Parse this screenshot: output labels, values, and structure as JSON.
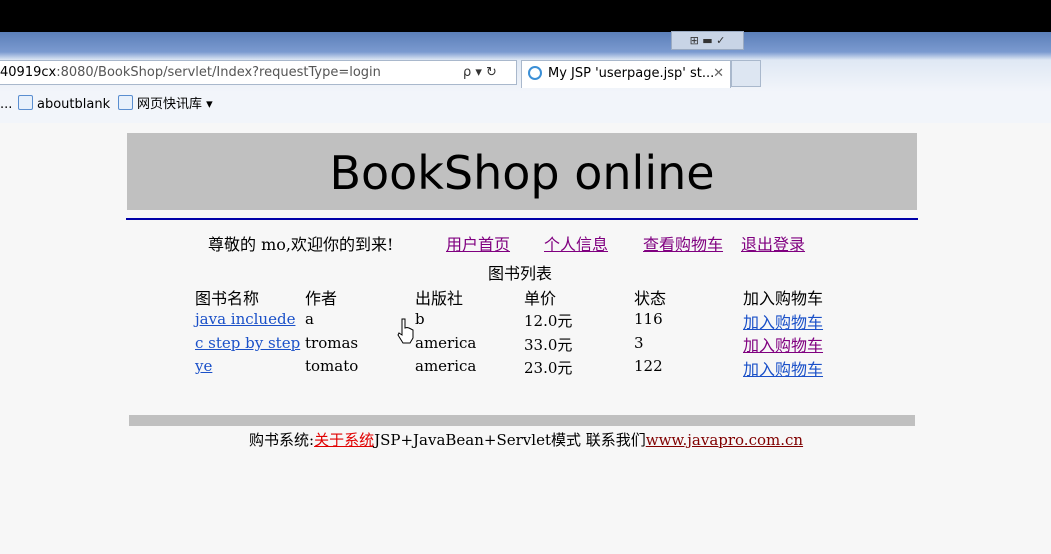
{
  "browser": {
    "address": {
      "host": "40919cx",
      "rest": ":8080/BookShop/servlet/Index?requestType=login"
    },
    "addr_icons": "ρ ▾ ↻",
    "tab": {
      "title": "My JSP 'userpage.jsp' st...",
      "close": "✕"
    },
    "window_controls": "⊞ ▬ ✓",
    "favorites": [
      {
        "label": "..."
      },
      {
        "label": "aboutblank"
      },
      {
        "label": "网页快讯库 ▾"
      }
    ]
  },
  "page": {
    "banner": "BookShop online",
    "welcome": "尊敬的 mo,欢迎你的到来!",
    "nav": [
      "用户首页",
      "个人信息",
      "查看购物车",
      "退出登录"
    ],
    "list_title": "图书列表",
    "columns": [
      "图书名称",
      "作者",
      "出版社",
      "单价",
      "状态",
      "加入购物车"
    ],
    "rows": [
      {
        "name": "java incluede",
        "author": "a",
        "publisher": "b",
        "price": "12.0元",
        "status": "116",
        "cart": "加入购物车"
      },
      {
        "name": "c step by step",
        "author": "tromas",
        "publisher": "america",
        "price": "33.0元",
        "status": "3",
        "cart": "加入购物车"
      },
      {
        "name": "ye",
        "author": "tomato",
        "publisher": "america",
        "price": "23.0元",
        "status": "122",
        "cart": "加入购物车"
      }
    ],
    "footer": {
      "prefix": "购书系统:",
      "about": "关于系统",
      "middle": "JSP+JavaBean+Servlet模式 联系我们",
      "link": "www.javapro.com.cn"
    }
  },
  "colors": {
    "nav_link": "#800080",
    "link": "#1a50c8",
    "banner_bg": "#c0c0c0",
    "rule": "#0000a8"
  }
}
